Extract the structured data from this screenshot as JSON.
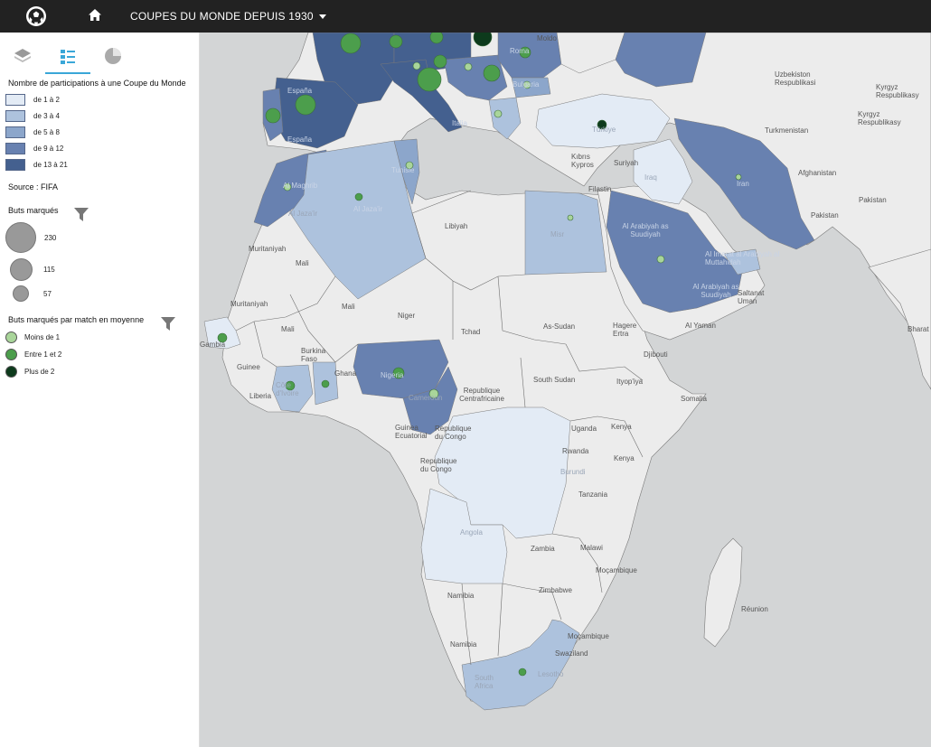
{
  "header": {
    "title": "COUPES DU MONDE DEPUIS 1930"
  },
  "sidebar": {
    "tabs": [
      {
        "name": "layers",
        "icon": "layers-icon"
      },
      {
        "name": "legend",
        "icon": "legend-list-icon"
      },
      {
        "name": "chart",
        "icon": "pie-chart-icon"
      }
    ],
    "choropleth": {
      "title": "Nombre de participations à une Coupe du Monde",
      "classes": [
        {
          "label": "de 1 à 2",
          "color": "#e3ebf5"
        },
        {
          "label": "de 3 à 4",
          "color": "#adc2dd"
        },
        {
          "label": "de 5 à 8",
          "color": "#8ca6cb"
        },
        {
          "label": "de 9 à 12",
          "color": "#6881b0"
        },
        {
          "label": "de 13 à 21",
          "color": "#44608f"
        }
      ]
    },
    "source": "Source : FIFA",
    "goals": {
      "title": "Buts marqués",
      "sizes": [
        {
          "label": "230",
          "value": 230
        },
        {
          "label": "115",
          "value": 115
        },
        {
          "label": "57",
          "value": 57
        }
      ]
    },
    "goals_per_match": {
      "title": "Buts marqués par match en moyenne",
      "classes": [
        {
          "label": "Moins de 1",
          "color": "#a9d59a"
        },
        {
          "label": "Entre 1 et 2",
          "color": "#4c9e4c"
        },
        {
          "label": "Plus de 2",
          "color": "#0d3a1c"
        }
      ]
    }
  },
  "map": {
    "labels": [
      {
        "text": "España"
      },
      {
        "text": "España"
      },
      {
        "text": "Italia"
      },
      {
        "text": "Roma"
      },
      {
        "text": "Bulgaria"
      },
      {
        "text": "Moldo"
      },
      {
        "text": "Türkiye"
      },
      {
        "text": "Uzbekiston Respublikasi"
      },
      {
        "text": "Kyrgyz Respublikasy"
      },
      {
        "text": "Kyrgyz Respublikasy"
      },
      {
        "text": "Turkmenistan"
      },
      {
        "text": "Afghanistan"
      },
      {
        "text": "Pakistan"
      },
      {
        "text": "Pakistan"
      },
      {
        "text": "Bharat"
      },
      {
        "text": "Iran"
      },
      {
        "text": "Iraq"
      },
      {
        "text": "Suriyah"
      },
      {
        "text": "Kıbrıs Kypros"
      },
      {
        "text": "Filastin"
      },
      {
        "text": "Al Maghrib"
      },
      {
        "text": "Tunisie"
      },
      {
        "text": "Al Jaza'ir"
      },
      {
        "text": "Al Jaza'ir"
      },
      {
        "text": "Libiyah"
      },
      {
        "text": "Misr"
      },
      {
        "text": "Al Arabiyah as Suudiyah"
      },
      {
        "text": "Al Arabiyah as Suudiyah"
      },
      {
        "text": "Al Imarat al Arabiyah al Muttahidah"
      },
      {
        "text": "Saltanat Uman"
      },
      {
        "text": "Al Yaman"
      },
      {
        "text": "Muritaniyah"
      },
      {
        "text": "Muritaniyah"
      },
      {
        "text": "Mali"
      },
      {
        "text": "Mali"
      },
      {
        "text": "Mali"
      },
      {
        "text": "Niger"
      },
      {
        "text": "Tchad"
      },
      {
        "text": "As-Sudan"
      },
      {
        "text": "Hagere Ertra"
      },
      {
        "text": "Djibouti"
      },
      {
        "text": "South Sudan"
      },
      {
        "text": "Ityop'iya"
      },
      {
        "text": "Somalia"
      },
      {
        "text": "Burkina Faso"
      },
      {
        "text": "Guinee"
      },
      {
        "text": "Liberia"
      },
      {
        "text": "Côte d'Ivoire"
      },
      {
        "text": "Ghana"
      },
      {
        "text": "Nigeria"
      },
      {
        "text": "Cameroun"
      },
      {
        "text": "Republique Centrafricaine"
      },
      {
        "text": "Guinea Ecuatorial"
      },
      {
        "text": "Republique du Congo"
      },
      {
        "text": "Republique du Congo"
      },
      {
        "text": "Uganda"
      },
      {
        "text": "Kenya"
      },
      {
        "text": "Kenya"
      },
      {
        "text": "Rwanda"
      },
      {
        "text": "Burundi"
      },
      {
        "text": "Tanzania"
      },
      {
        "text": "Angola"
      },
      {
        "text": "Zambia"
      },
      {
        "text": "Malawi"
      },
      {
        "text": "Moçambique"
      },
      {
        "text": "Moçambique"
      },
      {
        "text": "Zimbabwe"
      },
      {
        "text": "Namibia"
      },
      {
        "text": "Namibia"
      },
      {
        "text": "Swaziland"
      },
      {
        "text": "Lesotho"
      },
      {
        "text": "South Africa"
      },
      {
        "text": "Réunion"
      },
      {
        "text": "Gambia"
      }
    ]
  }
}
